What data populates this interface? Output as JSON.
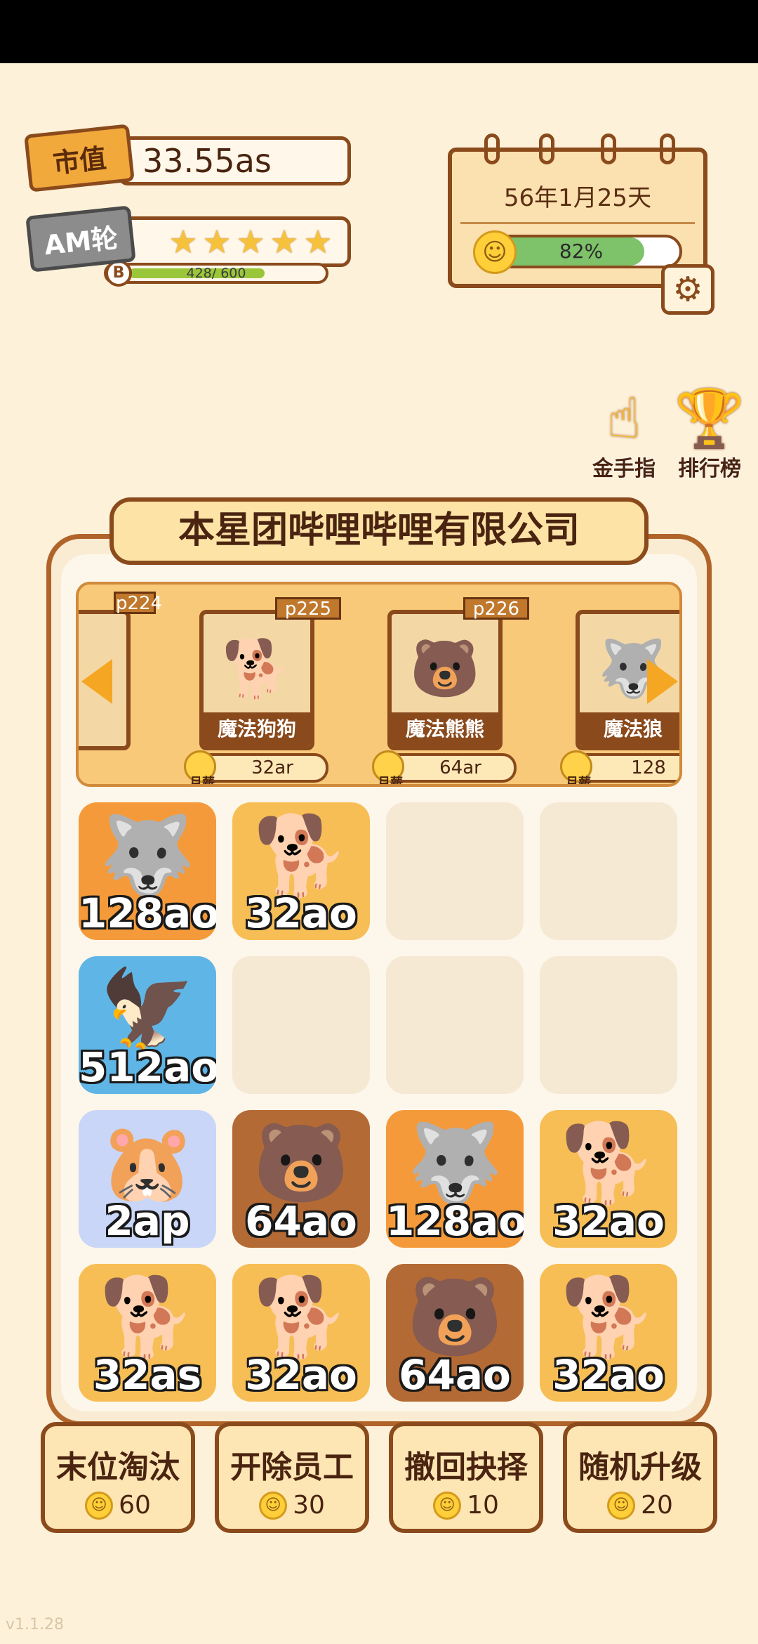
{
  "header": {
    "market_value_label": "市值",
    "market_value": "33.55as",
    "round_label": "AM轮",
    "round_stars": 5,
    "progress_badge": "B",
    "progress_text": "428/ 600",
    "progress_fraction": 0.713
  },
  "calendar": {
    "date": "56年1月25天",
    "mood_percent_text": "82%",
    "mood_fraction": 0.82,
    "mood_icon": "smile-face-icon",
    "settings_icon": "gear-icon"
  },
  "side_buttons": [
    {
      "label": "金手指",
      "icon": "pointing-hand-icon"
    },
    {
      "label": "排行榜",
      "icon": "trophy-icon"
    }
  ],
  "company": {
    "name": "本星团哔哩哔哩有限公司"
  },
  "shop": {
    "monthly_label": "月薪",
    "cards": [
      {
        "code": "p224",
        "name": "",
        "salary": ""
      },
      {
        "code": "p225",
        "name": "魔法狗狗",
        "salary": "32ar"
      },
      {
        "code": "p226",
        "name": "魔法熊熊",
        "salary": "64ar"
      },
      {
        "code": "",
        "name": "魔法狼",
        "salary": "128"
      }
    ]
  },
  "grid": [
    [
      {
        "value": "128ao",
        "animal": "wolf",
        "bg": "orange"
      },
      {
        "value": "32ao",
        "animal": "shiba",
        "bg": "gold"
      },
      null,
      null
    ],
    [
      {
        "value": "512ao",
        "animal": "eagle",
        "bg": "blue"
      },
      null,
      null,
      null
    ],
    [
      {
        "value": "2ap",
        "animal": "hamster",
        "bg": "lav"
      },
      {
        "value": "64ao",
        "animal": "bear",
        "bg": "brown"
      },
      {
        "value": "128ao",
        "animal": "wolf",
        "bg": "orange"
      },
      {
        "value": "32ao",
        "animal": "shiba",
        "bg": "gold"
      }
    ],
    [
      {
        "value": "32as",
        "animal": "shiba",
        "bg": "gold"
      },
      {
        "value": "32ao",
        "animal": "shiba",
        "bg": "gold"
      },
      {
        "value": "64ao",
        "animal": "bear",
        "bg": "brown"
      },
      {
        "value": "32ao",
        "animal": "shiba",
        "bg": "gold"
      }
    ]
  ],
  "actions": [
    {
      "label": "末位淘汰",
      "cost": "60"
    },
    {
      "label": "开除员工",
      "cost": "30"
    },
    {
      "label": "撤回抉择",
      "cost": "10"
    },
    {
      "label": "随机升级",
      "cost": "20"
    }
  ],
  "version": "v1.1.28",
  "colors": {
    "background": "#fdf1d9",
    "frame_brown": "#8a4a1c",
    "accent_orange": "#f5a623",
    "mood_green": "#7ec26a",
    "progress_green": "#9ac63a"
  }
}
